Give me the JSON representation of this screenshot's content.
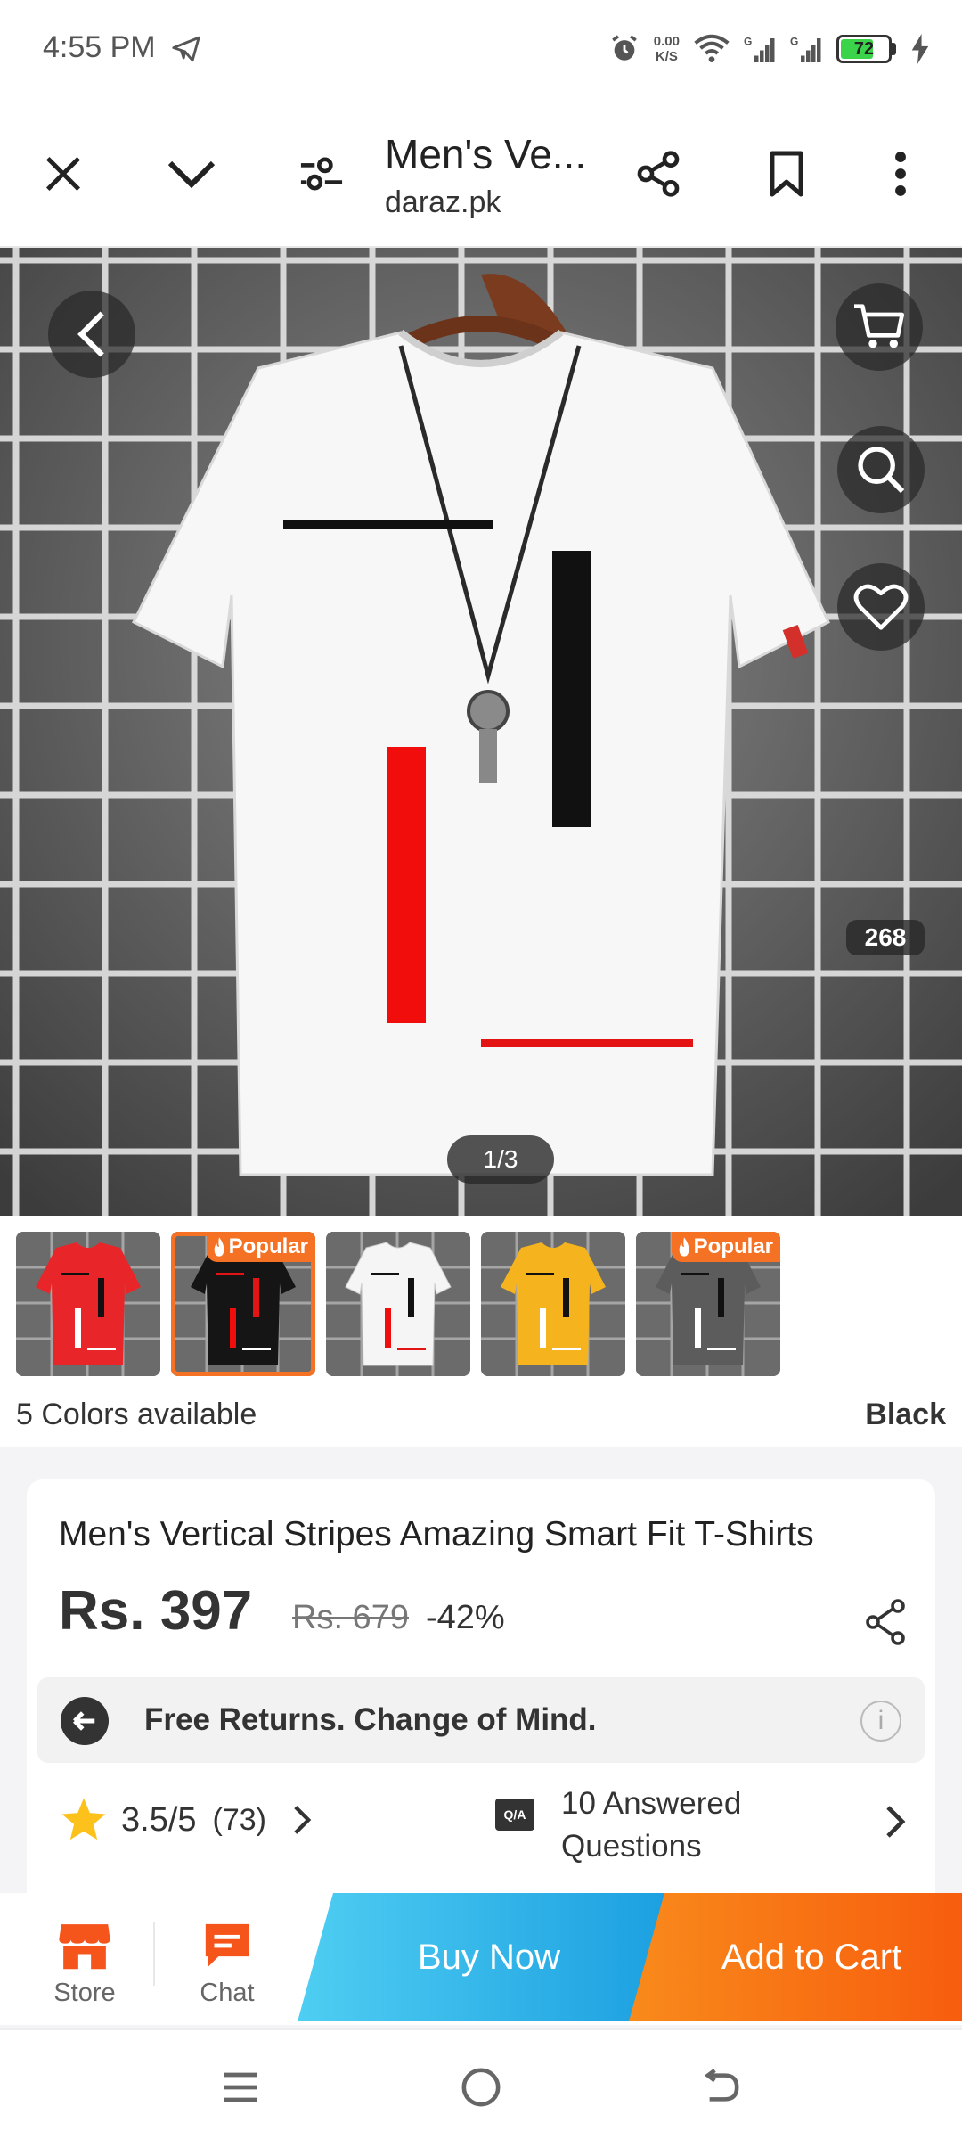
{
  "status_bar": {
    "time": "4:55 PM",
    "net_speed_value": "0.00",
    "net_speed_unit": "K/S",
    "battery": "72",
    "battery_level": 0.72
  },
  "browser": {
    "page_title": "Men's Ve...",
    "domain": "daraz.pk",
    "icons": [
      "close-icon",
      "chevron-down-icon",
      "tune-icon",
      "share-icon",
      "bookmark-icon",
      "more-vertical-icon"
    ]
  },
  "gallery": {
    "like_count": "268",
    "page_indicator": "1/3",
    "icons": [
      "chevron-left-icon",
      "cart-icon",
      "search-icon",
      "heart-icon"
    ]
  },
  "thumbnails": [
    {
      "color_name": "red",
      "shirt_color": "#e8262a",
      "badge": ""
    },
    {
      "color_name": "black",
      "shirt_color": "#151515",
      "badge": "Popular"
    },
    {
      "color_name": "white",
      "shirt_color": "#f5f5f5",
      "badge": ""
    },
    {
      "color_name": "yellow",
      "shirt_color": "#f5b41d",
      "badge": ""
    },
    {
      "color_name": "grey",
      "shirt_color": "#5c5c5c",
      "badge": "Popular"
    }
  ],
  "colors": {
    "available_text": "5 Colors available",
    "selected": "Black"
  },
  "product": {
    "title": "Men's Vertical Stripes Amazing Smart Fit T-Shirts",
    "price": "Rs. 397",
    "old_price": "Rs. 679",
    "discount": "-42%",
    "returns_text": "Free Returns. Change of Mind.",
    "info_symbol": "i",
    "rating": "3.5/5",
    "rating_count": "(73)",
    "qa_badge": "Q/A",
    "qa_text": "10 Answered Questions"
  },
  "actions": {
    "store_label": "Store",
    "chat_label": "Chat",
    "buy_now": "Buy Now",
    "add_to_cart": "Add to Cart"
  },
  "colors_theme": {
    "accent_orange": "#f57224",
    "buy_now_blue": "#2eb6ea",
    "star_yellow": "#fcc11a"
  }
}
